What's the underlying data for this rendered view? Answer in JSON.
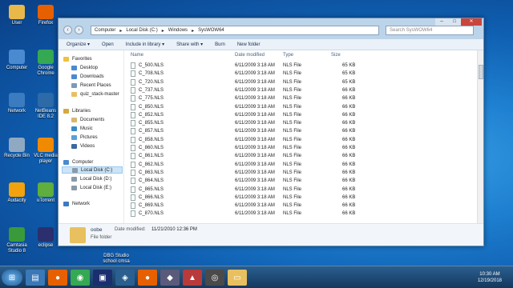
{
  "desktop": {
    "icons": [
      {
        "label": "User",
        "icon": "user-folder-icon",
        "color": "#e8b84a"
      },
      {
        "label": "Firefox",
        "icon": "firefox-icon",
        "color": "#e66000"
      },
      {
        "label": "Computer",
        "icon": "computer-icon",
        "color": "#4a8ad0"
      },
      {
        "label": "Google Chrome",
        "icon": "chrome-icon",
        "color": "#34a853"
      },
      {
        "label": "Network",
        "icon": "network-icon",
        "color": "#3b7bc0"
      },
      {
        "label": "NetBeans IDE 8.2",
        "icon": "netbeans-icon",
        "color": "#2c6aa8"
      },
      {
        "label": "Recycle Bin",
        "icon": "recycle-bin-icon",
        "color": "#8fa9c2"
      },
      {
        "label": "VLC media player",
        "icon": "vlc-icon",
        "color": "#f08a00"
      },
      {
        "label": "Audacity",
        "icon": "audacity-icon",
        "color": "#f2a20c"
      },
      {
        "label": "uTorrent",
        "icon": "utorrent-icon",
        "color": "#5fae3e"
      },
      {
        "label": "Camtasia Studio 8",
        "icon": "camtasia-icon",
        "color": "#3a9a3a"
      },
      {
        "label": "eclipse",
        "icon": "eclipse-icon",
        "color": "#2b2f6e"
      }
    ],
    "partial_labels": [
      "DBG Studio",
      "school",
      "cmsa"
    ]
  },
  "explorer": {
    "address": [
      "Computer",
      "Local Disk (C:)",
      "Windows",
      "SysWOW64"
    ],
    "search_placeholder": "Search SysWOW64",
    "toolbar": [
      "Organize ▾",
      "Open",
      "Include in library ▾",
      "Share with ▾",
      "Burn",
      "New folder"
    ],
    "nav": {
      "favorites_header": "Favorites",
      "favorites": [
        "Desktop",
        "Downloads",
        "Recent Places",
        "quiz_stack-master"
      ],
      "libraries_header": "Libraries",
      "libraries": [
        "Documents",
        "Music",
        "Pictures",
        "Videos"
      ],
      "computer_header": "Computer",
      "drives": [
        "Local Disk (C:)",
        "Local Disk (D:)",
        "Local Disk (E:)"
      ],
      "network_header": "Network"
    },
    "columns": {
      "name": "Name",
      "date": "Date modified",
      "type": "Type",
      "size": "Size"
    },
    "files": [
      {
        "name": "C_500.NLS",
        "date": "6/11/2009 3:18 AM",
        "type": "NLS File",
        "size": "65 KB"
      },
      {
        "name": "C_708.NLS",
        "date": "6/11/2009 3:18 AM",
        "type": "NLS File",
        "size": "65 KB"
      },
      {
        "name": "C_720.NLS",
        "date": "6/11/2009 3:18 AM",
        "type": "NLS File",
        "size": "65 KB"
      },
      {
        "name": "C_737.NLS",
        "date": "6/11/2009 3:18 AM",
        "type": "NLS File",
        "size": "66 KB"
      },
      {
        "name": "C_775.NLS",
        "date": "6/11/2009 3:18 AM",
        "type": "NLS File",
        "size": "66 KB"
      },
      {
        "name": "C_850.NLS",
        "date": "6/11/2009 3:18 AM",
        "type": "NLS File",
        "size": "66 KB"
      },
      {
        "name": "C_852.NLS",
        "date": "6/11/2009 3:18 AM",
        "type": "NLS File",
        "size": "66 KB"
      },
      {
        "name": "C_855.NLS",
        "date": "6/11/2009 3:18 AM",
        "type": "NLS File",
        "size": "66 KB"
      },
      {
        "name": "C_857.NLS",
        "date": "6/11/2009 3:18 AM",
        "type": "NLS File",
        "size": "66 KB"
      },
      {
        "name": "C_858.NLS",
        "date": "6/11/2009 3:18 AM",
        "type": "NLS File",
        "size": "66 KB"
      },
      {
        "name": "C_860.NLS",
        "date": "6/11/2009 3:18 AM",
        "type": "NLS File",
        "size": "66 KB"
      },
      {
        "name": "C_861.NLS",
        "date": "6/11/2009 3:18 AM",
        "type": "NLS File",
        "size": "66 KB"
      },
      {
        "name": "C_862.NLS",
        "date": "6/11/2009 3:18 AM",
        "type": "NLS File",
        "size": "66 KB"
      },
      {
        "name": "C_863.NLS",
        "date": "6/11/2009 3:18 AM",
        "type": "NLS File",
        "size": "66 KB"
      },
      {
        "name": "C_864.NLS",
        "date": "6/11/2009 3:18 AM",
        "type": "NLS File",
        "size": "66 KB"
      },
      {
        "name": "C_865.NLS",
        "date": "6/11/2009 3:18 AM",
        "type": "NLS File",
        "size": "66 KB"
      },
      {
        "name": "C_866.NLS",
        "date": "6/11/2009 3:18 AM",
        "type": "NLS File",
        "size": "66 KB"
      },
      {
        "name": "C_869.NLS",
        "date": "6/11/2009 3:18 AM",
        "type": "NLS File",
        "size": "66 KB"
      },
      {
        "name": "C_870.NLS",
        "date": "6/11/2009 3:18 AM",
        "type": "NLS File",
        "size": "66 KB"
      }
    ],
    "details": {
      "name": "oobe",
      "type": "File folder",
      "modified_label": "Date modified:",
      "modified": "11/21/2010 12:36 PM"
    }
  },
  "taskbar": {
    "time": "10:30 AM",
    "date": "12/19/2018"
  }
}
